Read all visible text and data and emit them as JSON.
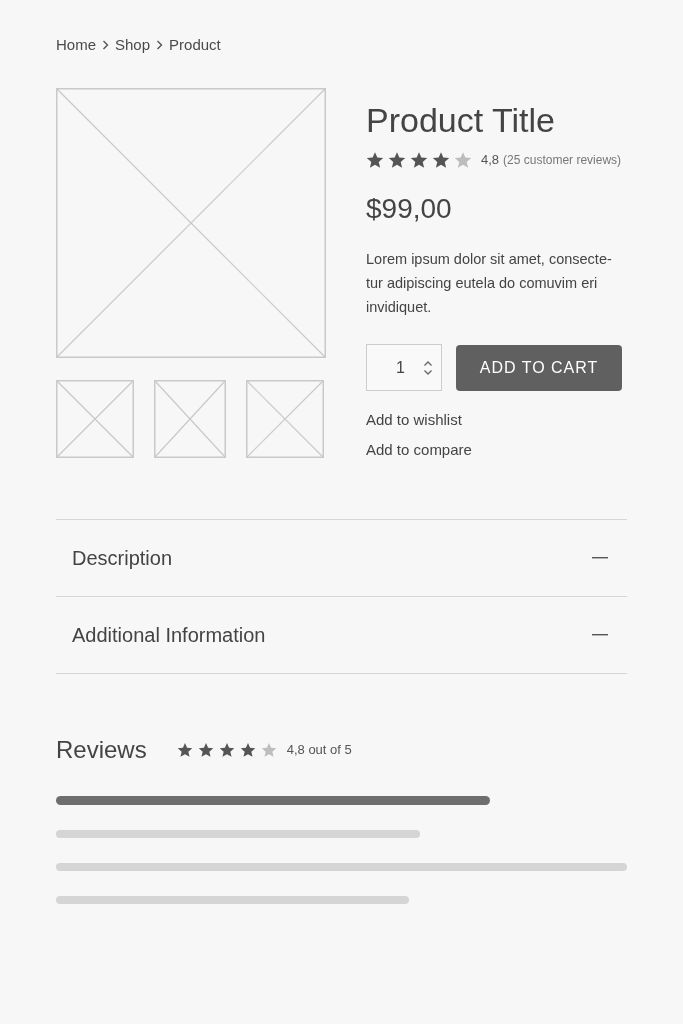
{
  "breadcrumb": [
    {
      "label": "Home"
    },
    {
      "label": "Shop"
    },
    {
      "label": "Product"
    }
  ],
  "product": {
    "title": "Product Title",
    "rating": {
      "stars": 4,
      "score": "4,8",
      "reviews": "(25 customer reviews)"
    },
    "price": "$99,00",
    "description": "Lorem ipsum dolor sit amet, consecte-tur adipiscing eutela do comuvim eri invidiquet.",
    "quantity": {
      "value": "1"
    },
    "add_to_cart": "ADD TO CART",
    "links": [
      "Add to wishlist",
      "Add to compare"
    ]
  },
  "accordion": [
    {
      "label": "Description"
    },
    {
      "label": "Additional Information"
    }
  ],
  "reviews": {
    "title": "Reviews",
    "stars": 4,
    "summary": "4,8 out of 5"
  }
}
